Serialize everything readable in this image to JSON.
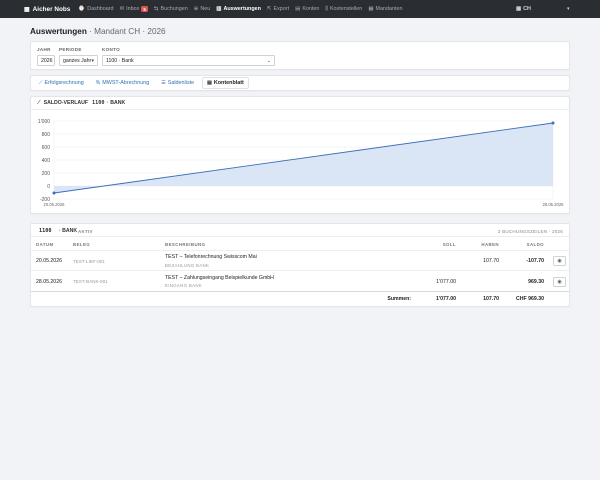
{
  "nav": {
    "brand": "Aicher Nobs",
    "items": [
      {
        "label": "Dashboard",
        "icon": "dashboard-icon",
        "glyph": "⌚"
      },
      {
        "label": "Inbox",
        "icon": "inbox-icon",
        "glyph": "✉",
        "badge": "5"
      },
      {
        "label": "Buchungen",
        "icon": "bookings-icon",
        "glyph": "⇆"
      },
      {
        "label": "Neu",
        "icon": "plus-circle-icon",
        "glyph": "⊕"
      },
      {
        "label": "Auswertungen",
        "icon": "chart-icon",
        "glyph": "▥",
        "active": true
      },
      {
        "label": "Export",
        "icon": "export-icon",
        "glyph": "⇱"
      },
      {
        "label": "Konten",
        "icon": "accounts-icon",
        "glyph": "▤"
      },
      {
        "label": "Kostenstellen",
        "icon": "cost-center-icon",
        "glyph": "⫼"
      },
      {
        "label": "Mandanten",
        "icon": "clients-icon",
        "glyph": "▦"
      }
    ],
    "client_switch": "CH",
    "client_icon": "building-icon"
  },
  "page": {
    "title": "Auswertungen",
    "subtitle": "Mandant CH · 2026"
  },
  "filters": {
    "year_label": "JAHR",
    "year_value": "2026",
    "period_label": "PERIODE",
    "period_value": "ganzes Jahr",
    "account_label": "KONTO",
    "account_value": "1100 · Bank"
  },
  "tabs": [
    {
      "label": "Erfolgsrechnung",
      "icon": "line-chart-icon",
      "glyph": "⟋"
    },
    {
      "label": "MWST-Abrechnung",
      "icon": "percent-icon",
      "glyph": "%"
    },
    {
      "label": "Saldenliste",
      "icon": "list-icon",
      "glyph": "☰"
    },
    {
      "label": "Kontenblatt",
      "icon": "ledger-icon",
      "glyph": "▤",
      "active": true
    }
  ],
  "chart_section": {
    "heading": "SALDO-VERLAUF",
    "account_no": "1100",
    "account_name": "BANK"
  },
  "chart_data": {
    "type": "area",
    "x": [
      "20.05.2026",
      "28.05.2026"
    ],
    "series": [
      {
        "values": [
          -107.7,
          969.3
        ]
      }
    ],
    "ylim": [
      -200,
      1000
    ],
    "yticks": [
      "1'000",
      "800",
      "600",
      "400",
      "200",
      "0",
      "-200"
    ],
    "xticks": [
      "20.05.2026",
      "28.05.2026"
    ],
    "grid": true,
    "line_color": "#3b6fb6",
    "fill_color": "#d6e3f5"
  },
  "ledger": {
    "account_no": "1100",
    "account_name": "· BANK",
    "status": "AKTIV",
    "count": "2 BUCHUNGSZEILEN · 2026",
    "headers": {
      "date": "DATUM",
      "voucher": "BELEG",
      "description": "BESCHREIBUNG",
      "debit": "SOLL",
      "credit": "HABEN",
      "balance": "SALDO"
    },
    "rows": [
      {
        "date": "20.05.2026",
        "voucher": "TEST-LIEF-001",
        "description": "TEST – Telefonrechnung Swisscom Mai",
        "sub": "BEZAHLUNG BANK",
        "debit": "",
        "credit": "107.70",
        "balance": "-107.70"
      },
      {
        "date": "28.05.2026",
        "voucher": "TEST-BANK-001",
        "description": "TEST – Zahlungseingang Beispielkunde GmbH",
        "sub": "EINGANG BANK",
        "debit": "1'077.00",
        "credit": "",
        "balance": "969.30"
      }
    ],
    "totals": {
      "label": "Summen:",
      "debit": "1'077.00",
      "credit": "107.70",
      "balance": "CHF 969.30"
    }
  }
}
